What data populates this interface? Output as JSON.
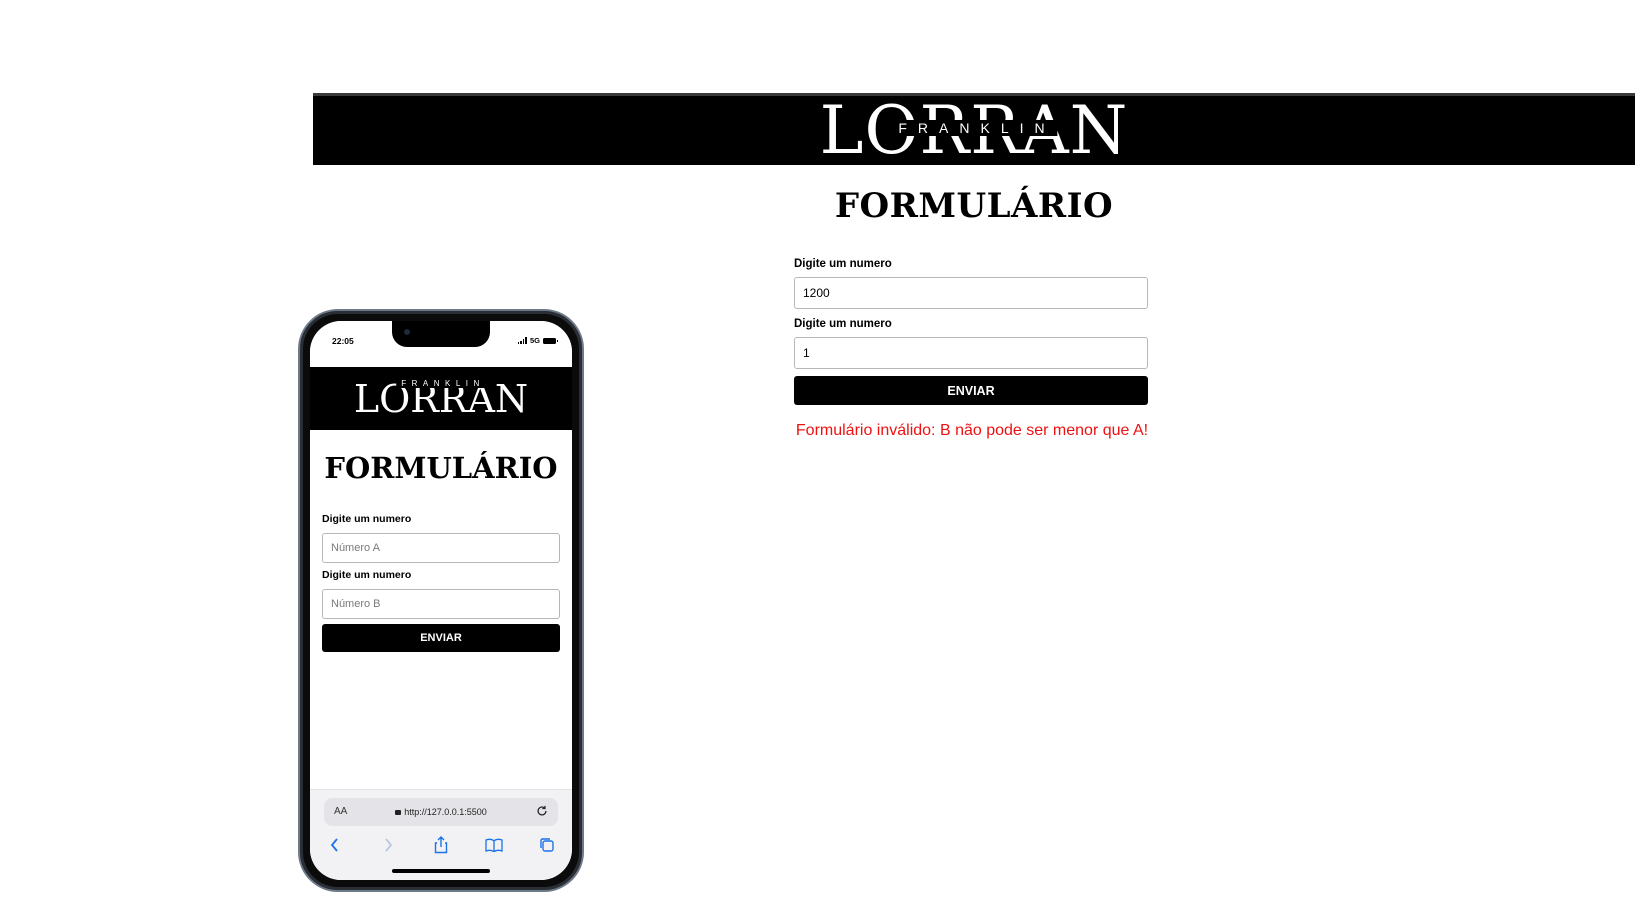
{
  "desktop": {
    "logo_main": "LORRAN",
    "logo_sub": "FRANKLIN",
    "title": "FORMULÁRIO",
    "label_a": "Digite um numero",
    "value_a": "1200",
    "label_b": "Digite um numero",
    "value_b": "1",
    "submit_label": "ENVIAR",
    "error_message": "Formulário inválido: B não pode ser menor que A!",
    "error_color": "#ee1111"
  },
  "phone": {
    "status": {
      "time": "22:05",
      "network": "5G"
    },
    "logo_main": "LORRAN",
    "logo_sub": "FRANKLIN",
    "title": "FORMULÁRIO",
    "label_a": "Digite um numero",
    "placeholder_a": "Número A",
    "label_b": "Digite um numero",
    "placeholder_b": "Número B",
    "submit_label": "ENVIAR",
    "browser": {
      "text_size_label": "AA",
      "url": "http://127.0.0.1:5500",
      "toolbar_icons": [
        "back-icon",
        "forward-icon",
        "share-icon",
        "bookmarks-icon",
        "tabs-icon"
      ]
    }
  },
  "colors": {
    "header_bg": "#000000",
    "button_bg": "#000000",
    "page_bg": "#ffffff"
  }
}
